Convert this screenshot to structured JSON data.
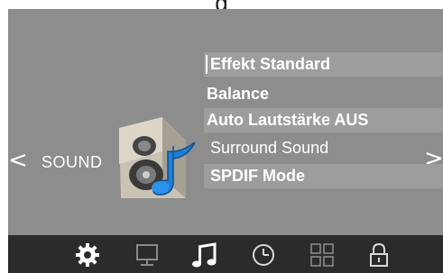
{
  "header": {
    "glyph": "g"
  },
  "sound_menu": {
    "section_label": "SOUND",
    "nav_prev": "<",
    "nav_next": ">",
    "items": [
      {
        "label": "Effekt Standard"
      },
      {
        "label": "Balance"
      },
      {
        "label": "Auto Lautstärke AUS"
      },
      {
        "label": "Surround Sound"
      },
      {
        "label": "SPDIF Mode"
      }
    ]
  },
  "tabs": [
    {
      "icon": "gear-icon",
      "active": true
    },
    {
      "icon": "monitor-icon",
      "active": false
    },
    {
      "icon": "music-note-icon",
      "active": true
    },
    {
      "icon": "clock-icon",
      "active": false
    },
    {
      "icon": "grid-icon",
      "active": false
    },
    {
      "icon": "lock-icon",
      "active": false
    }
  ],
  "colors": {
    "screen_bg": "#8d8d8d",
    "highlight_bar": "#9d9d9d",
    "bottom_bar": "#2b2b2b",
    "accent_blue": "#1e7fd6"
  }
}
